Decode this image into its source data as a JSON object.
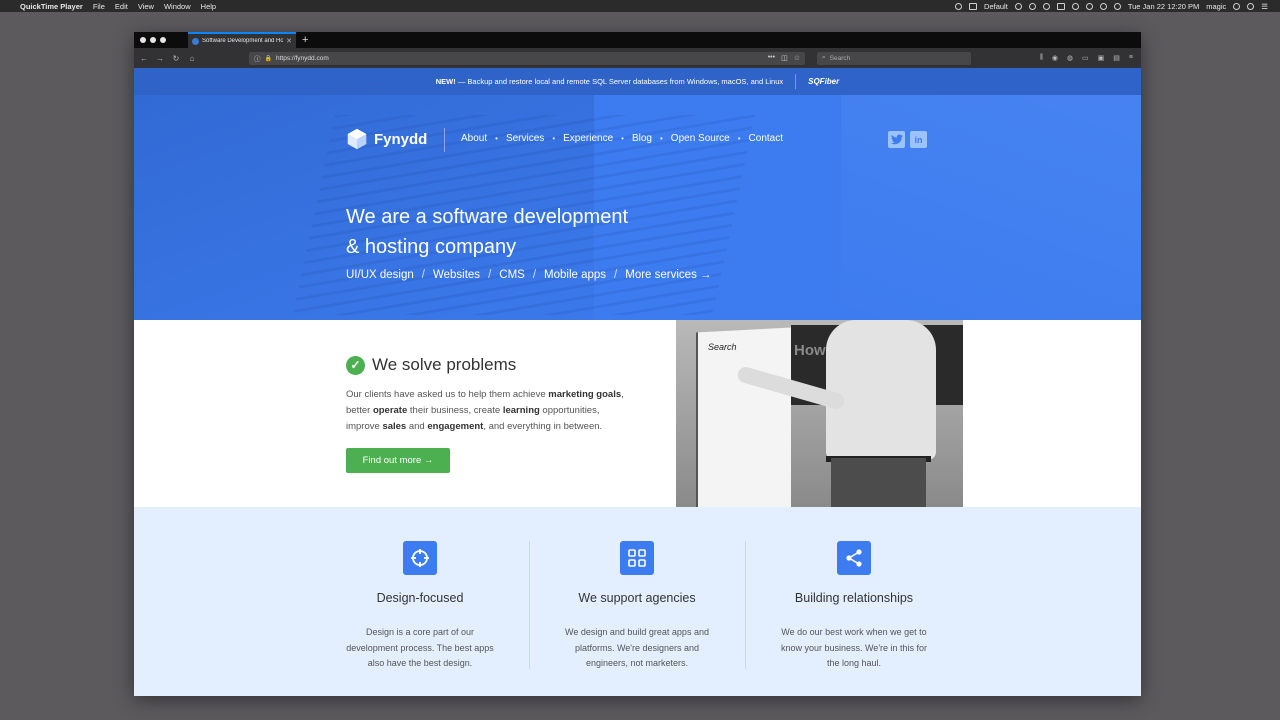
{
  "menubar": {
    "app_name": "QuickTime Player",
    "menus": [
      "File",
      "Edit",
      "View",
      "Window",
      "Help"
    ],
    "keyboard": "Default",
    "datetime": "Tue Jan 22  12:20 PM",
    "user": "magic"
  },
  "browser": {
    "tab_title": "Software Development and Ho...",
    "url": "https://fynydd.com",
    "search_placeholder": "Search"
  },
  "announce": {
    "new_label": "NEW!",
    "text": "— Backup and restore local and remote SQL Server databases from Windows, macOS, and Linux",
    "brand": "SQFiber"
  },
  "header": {
    "logo_text": "Fynydd",
    "nav": [
      "About",
      "Services",
      "Experience",
      "Blog",
      "Open Source",
      "Contact"
    ]
  },
  "hero": {
    "headline_line1": "We are a software development",
    "headline_line2": "& hosting company",
    "services": [
      "UI/UX design",
      "Websites",
      "CMS",
      "Mobile apps",
      "More services →"
    ]
  },
  "solve": {
    "title": "We solve problems",
    "t1": "Our clients have asked us to help them achieve ",
    "b1": "marketing goals",
    "t2": ",",
    "t3": "better ",
    "b2": "operate",
    "t4": " their business, create ",
    "b3": "learning",
    "t5": " opportunities,",
    "t6": "improve ",
    "b4": "sales",
    "t7": " and ",
    "b5": "engagement",
    "t8": ", and everything in between.",
    "button": "Find out more →"
  },
  "photo": {
    "scribble": "Search",
    "tv_text": "How"
  },
  "features": [
    {
      "title": "Design-focused",
      "text": "Design is a core part of our development process. The best apps also have the best design."
    },
    {
      "title": "We support agencies",
      "text": "We design and build great apps and platforms. We're designers and engineers, not marketers."
    },
    {
      "title": "Building relationships",
      "text": "We do our best work when we get to know your business. We're in this for the long haul."
    }
  ],
  "colors": {
    "brand_blue": "#3d7cf0",
    "green": "#4cb050",
    "feature_bg": "#e3efff"
  }
}
